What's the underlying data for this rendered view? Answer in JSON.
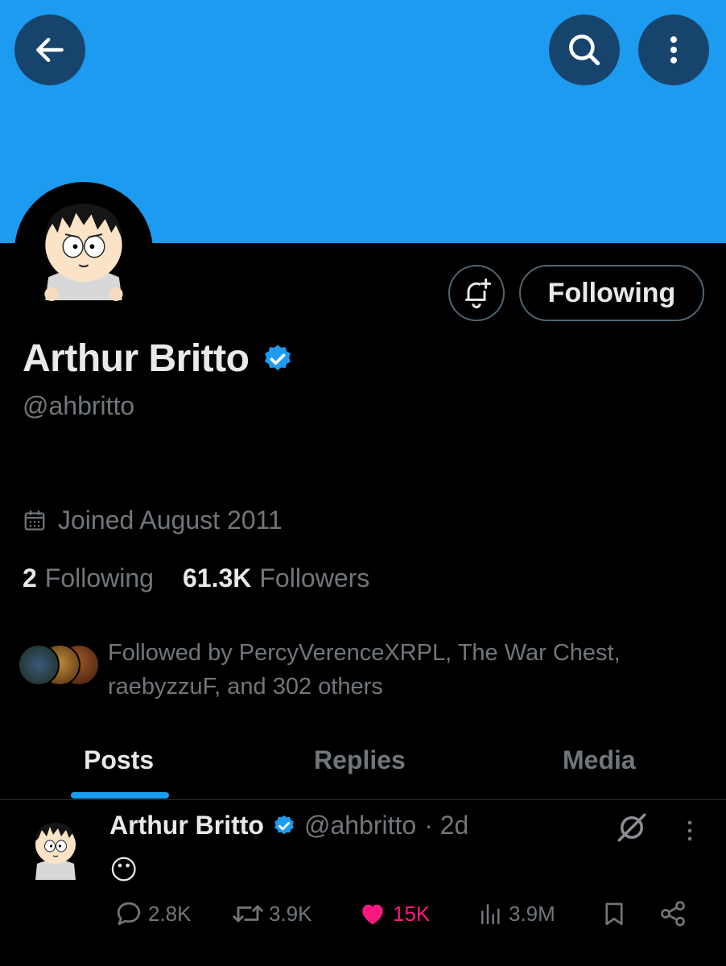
{
  "banner": {
    "color": "#1d9bf0"
  },
  "header": {
    "back_icon": "arrow-left-icon",
    "search_icon": "search-icon",
    "more_icon": "more-vertical-icon"
  },
  "profile": {
    "display_name": "Arthur Britto",
    "handle": "@ahbritto",
    "verified": true,
    "joined": "Joined August 2011",
    "following_count": "2",
    "following_label": "Following",
    "followers_count": "61.3K",
    "followers_label": "Followers",
    "followed_by": "Followed by PercyVerenceXRPL, The War Chest, raebyzzuF, and 302 others"
  },
  "actions": {
    "notify_icon": "bell-plus-icon",
    "follow_state_label": "Following"
  },
  "tabs": [
    {
      "label": "Posts",
      "active": true
    },
    {
      "label": "Replies",
      "active": false
    },
    {
      "label": "Media",
      "active": false
    }
  ],
  "post": {
    "author": "Arthur Britto",
    "handle": "@ahbritto",
    "time": "· 2d",
    "body": "😶",
    "replies": "2.8K",
    "reposts": "3.9K",
    "likes": "15K",
    "views": "3.9M"
  },
  "colors": {
    "accent": "#1d9bf0",
    "like": "#f91880",
    "muted": "#71767b",
    "text": "#e7e9ea",
    "header_button": "#17446d"
  }
}
